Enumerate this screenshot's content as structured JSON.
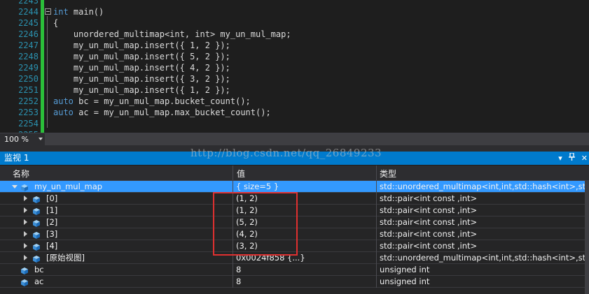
{
  "editor": {
    "lines": [
      {
        "num": "2243",
        "code": ""
      },
      {
        "num": "2244",
        "kw": "int",
        "code": " main()"
      },
      {
        "num": "2245",
        "code": "{"
      },
      {
        "num": "2246",
        "kw": "",
        "code": "    unordered_multimap<int, int> my_un_mul_map;"
      },
      {
        "num": "2247",
        "code": "    my_un_mul_map.insert({ 1, 2 });"
      },
      {
        "num": "2248",
        "code": "    my_un_mul_map.insert({ 5, 2 });"
      },
      {
        "num": "2249",
        "code": "    my_un_mul_map.insert({ 4, 2 });"
      },
      {
        "num": "2250",
        "code": "    my_un_mul_map.insert({ 3, 2 });"
      },
      {
        "num": "2251",
        "code": "    my_un_mul_map.insert({ 1, 2 });"
      },
      {
        "num": "2252",
        "kw": "auto",
        "code": " bc = my_un_mul_map.bucket_count();"
      },
      {
        "num": "2253",
        "kw": "auto",
        "code": " ac = my_un_mul_map.max_bucket_count();"
      },
      {
        "num": "2254",
        "code": ""
      },
      {
        "num": "2255",
        "code": ""
      }
    ]
  },
  "zoom": {
    "value": "100 %"
  },
  "watermark": "http://blog.csdn.net/qq_26849233",
  "watch": {
    "title": "监视 1",
    "icons": [
      "dropdown-icon",
      "pin-icon",
      "close-icon"
    ],
    "columns": {
      "name": "名称",
      "value": "值",
      "type": "类型"
    },
    "rows": [
      {
        "name": "my_un_mul_map",
        "value": "{ size=5 }",
        "type": "std::unordered_multimap<int,int,std::hash<int>,std::eq",
        "level": 0,
        "expander": "expanded",
        "selected": true
      },
      {
        "name": "[0]",
        "value": "(1, 2)",
        "type": "std::pair<int const ,int>",
        "level": 1,
        "expander": "collapsed"
      },
      {
        "name": "[1]",
        "value": "(1, 2)",
        "type": "std::pair<int const ,int>",
        "level": 1,
        "expander": "collapsed"
      },
      {
        "name": "[2]",
        "value": "(5, 2)",
        "type": "std::pair<int const ,int>",
        "level": 1,
        "expander": "collapsed"
      },
      {
        "name": "[3]",
        "value": "(4, 2)",
        "type": "std::pair<int const ,int>",
        "level": 1,
        "expander": "collapsed"
      },
      {
        "name": "[4]",
        "value": "(3, 2)",
        "type": "std::pair<int const ,int>",
        "level": 1,
        "expander": "collapsed"
      },
      {
        "name": "[原始视图]",
        "value": "0x0024f858 {...}",
        "type": "std::unordered_multimap<int,int,std::hash<int>,std::eq",
        "level": 1,
        "expander": "collapsed"
      },
      {
        "name": "bc",
        "value": "8",
        "type": "unsigned int",
        "level": 0,
        "expander": "none"
      },
      {
        "name": "ac",
        "value": "8",
        "type": "unsigned int",
        "level": 0,
        "expander": "none"
      }
    ]
  },
  "colors": {
    "accent": "#007acc",
    "selected_row": "#3399ff",
    "highlight_box": "#e03030",
    "editor_green_bar": "#2bbf3a"
  }
}
